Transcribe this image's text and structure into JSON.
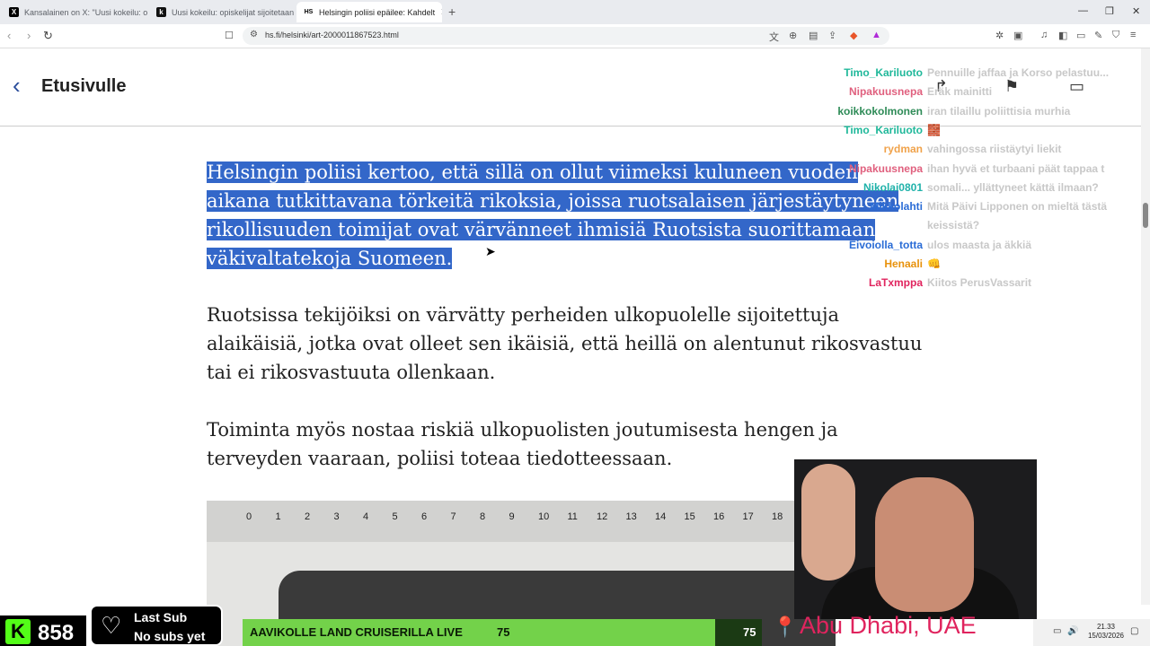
{
  "tabs": [
    {
      "label": "Kansalainen on X: \"Uusi kokeilu: opis",
      "favicon": "X",
      "favicon_color": "#000000"
    },
    {
      "label": "Uusi kokeilu: opiskelijat sijoitetaan in",
      "favicon": "k",
      "favicon_color": "#111111"
    },
    {
      "label": "Helsingin poliisi epäilee: Kahdelt",
      "favicon": "HS",
      "favicon_color": "#ffffff"
    }
  ],
  "address_bar": {
    "url": "hs.fi/helsinki/art-2000011867523.html"
  },
  "site_header": {
    "back_label": "Etusivulle",
    "back_icon": "chevron-left-icon",
    "accent": "#2a4d9b"
  },
  "article": {
    "paragraph_1": "Helsingin poliisi kertoo, että sillä on ollut viimeksi kuluneen vuoden aikana tutkittavana törkeitä rikoksia, joissa ruotsalaisen järjestäytyneen rikollisuuden toimijat ovat värvänneet ihmisiä Ruotsista suorittamaan väkivaltatekoja Suomeen.",
    "paragraph_2": "Ruotsissa tekijöiksi on värvätty perheiden ulkopuolelle sijoitettuja alaikäisiä, jotka ovat olleet sen ikäisiä, että heillä on alentunut rikosvastuu tai ei rikosvastuuta ollenkaan.",
    "paragraph_3": "Toiminta myös nostaa riskiä ulkopuolisten joutumisesta hengen ja terveyden vaaraan, poliisi toteaa tiedotteessaan.",
    "ruler_numbers": [
      "0",
      "1",
      "2",
      "3",
      "4",
      "5",
      "6",
      "7",
      "8",
      "9",
      "10",
      "11",
      "12",
      "13",
      "14",
      "15",
      "16",
      "17",
      "18"
    ]
  },
  "chat": [
    {
      "name": "Timo_Kariluoto",
      "color": "#1fb89a",
      "message": "Pennuille jaffaa ja Korso pelastuu..."
    },
    {
      "name": "Nipakuusnepa",
      "color": "#e0607e",
      "message": "Eräk mainitti"
    },
    {
      "name": "koikkokolmonen",
      "color": "#2e8b57",
      "message": "iran tilaillu poliittisia murhia"
    },
    {
      "name": "Timo_Kariluoto",
      "color": "#1fb89a",
      "message": "🧱"
    },
    {
      "name": "rydman",
      "color": "#f0a24a",
      "message": "vahingossa riistäytyi liekit"
    },
    {
      "name": "Nipakuusnepa",
      "color": "#e0607e",
      "message": "ihan hyvä et turbaani päät tappaa t"
    },
    {
      "name": "Nikolai0801",
      "color": "#20b2aa",
      "message": "somali... yllättyneet kättä ilmaan?"
    },
    {
      "name": "Mikkolahti",
      "color": "#2a6cd6",
      "message": "Mitä Päivi Lipponen on mieltä tästä"
    },
    {
      "name": "",
      "color": "#2a6cd6",
      "message": "keissistä?"
    },
    {
      "name": "Eivoiolla_totta",
      "color": "#2a6cd6",
      "message": "ulos maasta ja äkkiä"
    },
    {
      "name": "Henaali",
      "color": "#e8920c",
      "message": "👊"
    },
    {
      "name": "LaTxmppa",
      "color": "#e0245e",
      "message": "Kiitos PerusVassarit"
    }
  ],
  "stream": {
    "kick_count": "858",
    "last_sub_label": "Last Sub",
    "last_sub_value": "No subs yet",
    "goal_label": "AAVIKOLLE LAND CRUISERILLA LIVE",
    "goal_current": "75",
    "goal_target": "75",
    "goal_progress": 0.91,
    "location": "Abu Dhabi, UAE",
    "accent": "#53fc18"
  },
  "taskbar": {
    "time": "21.33",
    "date": "15/03/2026"
  }
}
